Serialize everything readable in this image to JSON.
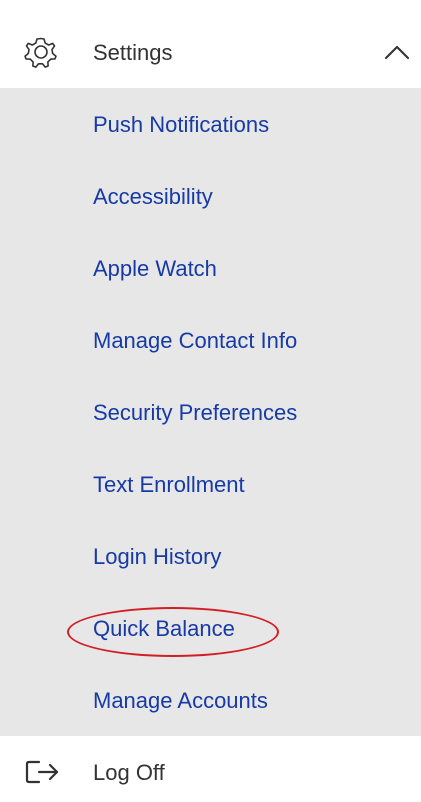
{
  "menu": {
    "settings": {
      "label": "Settings",
      "icon": "gear-icon",
      "expand_icon": "chevron-up-icon"
    },
    "items": [
      {
        "label": "Push Notifications"
      },
      {
        "label": "Accessibility"
      },
      {
        "label": "Apple Watch"
      },
      {
        "label": "Manage Contact Info"
      },
      {
        "label": "Security Preferences"
      },
      {
        "label": "Text Enrollment"
      },
      {
        "label": "Login History"
      },
      {
        "label": "Quick Balance"
      },
      {
        "label": "Manage Accounts"
      }
    ],
    "log_off": {
      "label": "Log Off",
      "icon": "log-out-icon"
    }
  },
  "colors": {
    "header_background": "#ffffff",
    "submenu_background": "#e7e7e7",
    "link_text": "#163aa6",
    "dark_text": "#333333",
    "annotation_ring": "#d21f24"
  }
}
